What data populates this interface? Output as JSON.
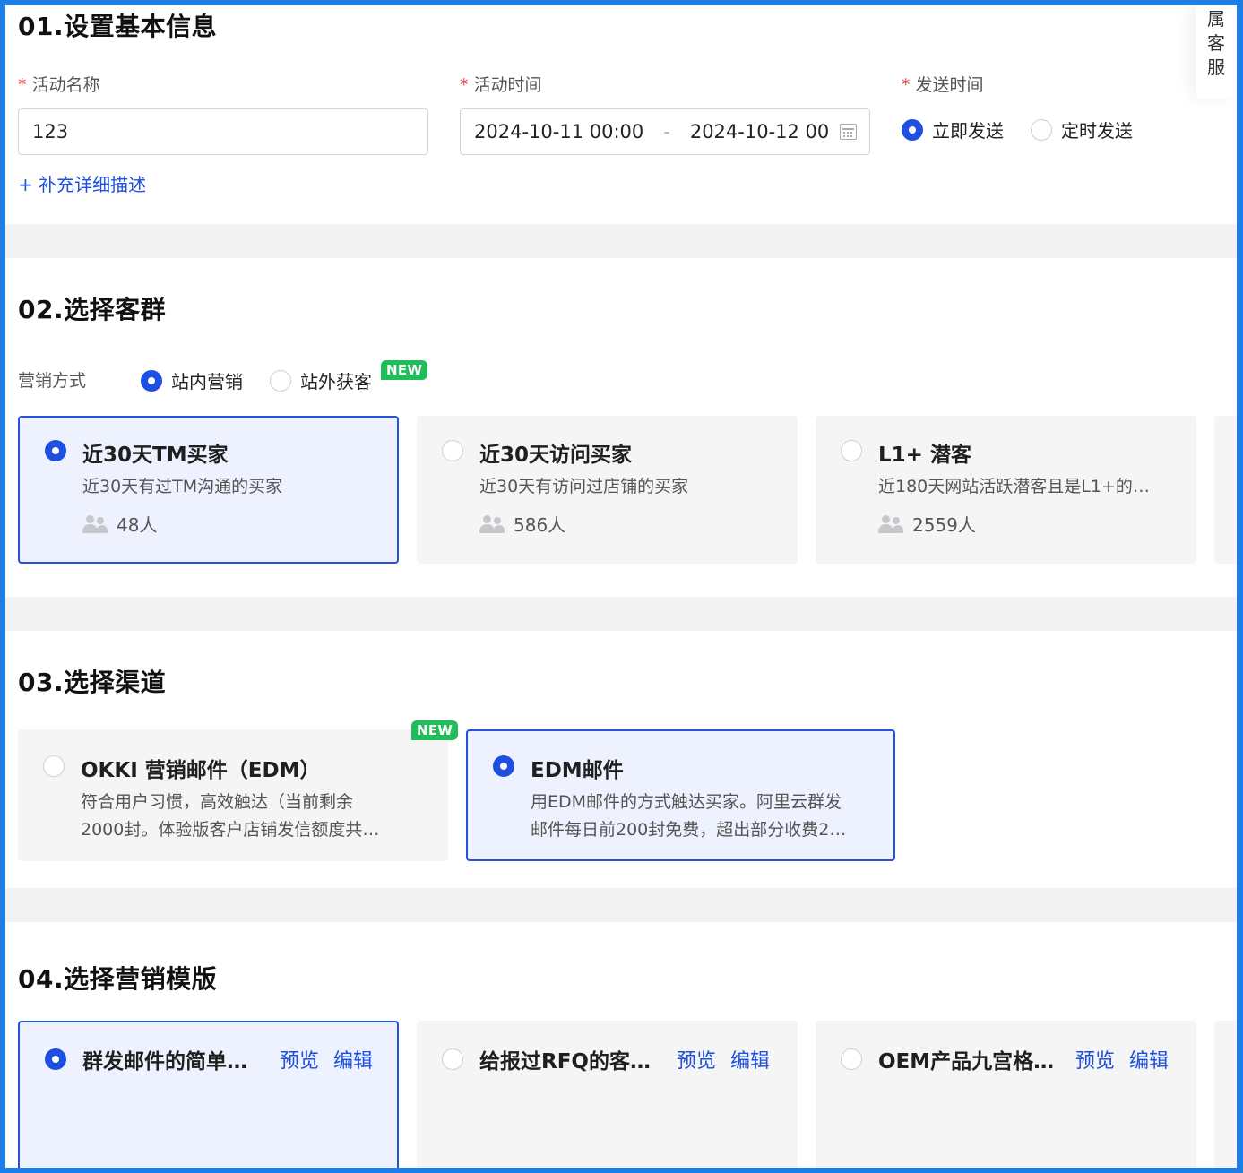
{
  "section1": {
    "title": "01.设置基本信息",
    "activity_name": {
      "label": "活动名称",
      "required_mark": "*",
      "value": "123"
    },
    "activity_time": {
      "label": "活动时间",
      "required_mark": "*",
      "start": "2024-10-11 00:00",
      "separator": "-",
      "end": "2024-10-12 00"
    },
    "send_time": {
      "label": "发送时间",
      "required_mark": "*",
      "options": [
        {
          "label": "立即发送",
          "selected": true
        },
        {
          "label": "定时发送",
          "selected": false
        }
      ]
    },
    "add_description": "+ 补充详细描述"
  },
  "side_widget": {
    "chars": [
      "属",
      "客",
      "服"
    ]
  },
  "section2": {
    "title": "02.选择客群",
    "mode_label": "营销方式",
    "modes": [
      {
        "label": "站内营销",
        "selected": true
      },
      {
        "label": "站外获客",
        "selected": false,
        "badge": "NEW"
      }
    ],
    "cards": [
      {
        "title": "近30天TM买家",
        "desc": "近30天有过TM沟通的买家",
        "count": "48人",
        "selected": true
      },
      {
        "title": "近30天访问买家",
        "desc": "近30天有访问过店铺的买家",
        "count": "586人",
        "selected": false
      },
      {
        "title": "L1+ 潜客",
        "desc": "近180天网站活跃潜客且是L1+的…",
        "count": "2559人",
        "selected": false
      }
    ]
  },
  "section3": {
    "title": "03.选择渠道",
    "cards": [
      {
        "title": "OKKI 营销邮件（EDM）",
        "desc1": "符合用户习惯，高效触达（当前剩余",
        "desc2": "2000封。体验版客户店铺发信额度共…",
        "badge": "NEW",
        "selected": false
      },
      {
        "title": "EDM邮件",
        "desc1": "用EDM邮件的方式触达买家。阿里云群发",
        "desc2": "邮件每日前200封免费，超出部分收费2…",
        "selected": true
      }
    ]
  },
  "section4": {
    "title": "04.选择营销模版",
    "preview_label": "预览",
    "edit_label": "编辑",
    "templates": [
      {
        "name": "群发邮件的简单…",
        "selected": true
      },
      {
        "name": "给报过RFQ的客…",
        "selected": false
      },
      {
        "name": "OEM产品九宫格…",
        "selected": false
      }
    ]
  },
  "colors": {
    "primary": "#1d4fe0",
    "selected_bg": "#eef2fe",
    "badge_green": "#1fbe5a",
    "required": "#e5484d",
    "frame": "#1d7fe6"
  }
}
